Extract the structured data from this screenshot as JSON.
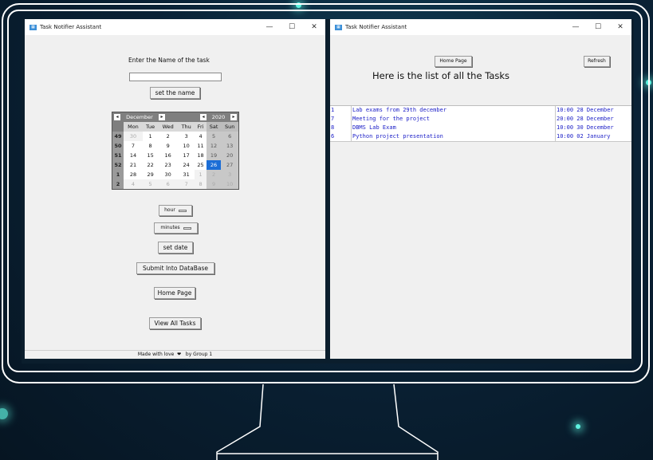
{
  "colors": {
    "background": "#0a2236",
    "accent_glow": "#5ef3e0",
    "list_text": "#1f22c8",
    "selected_day": "#1c6ed6"
  },
  "left_window": {
    "icon": "app-icon",
    "title": "Task Notifier Assistant",
    "controls": {
      "minimize": "—",
      "maximize": "☐",
      "close": "✕"
    },
    "task_label": "Enter the Name of the task",
    "task_input_value": "",
    "set_name_button": "set the name",
    "calendar": {
      "month": "December",
      "year": "2020",
      "prev_arrow": "◂",
      "next_arrow": "▸",
      "weekdays": [
        "Mon",
        "Tue",
        "Wed",
        "Thu",
        "Fri",
        "Sat",
        "Sun"
      ],
      "weeks": [
        {
          "num": "49",
          "days": [
            "30",
            "1",
            "2",
            "3",
            "4",
            "5",
            "6"
          ]
        },
        {
          "num": "50",
          "days": [
            "7",
            "8",
            "9",
            "10",
            "11",
            "12",
            "13"
          ]
        },
        {
          "num": "51",
          "days": [
            "14",
            "15",
            "16",
            "17",
            "18",
            "19",
            "20"
          ]
        },
        {
          "num": "52",
          "days": [
            "21",
            "22",
            "23",
            "24",
            "25",
            "26",
            "27"
          ]
        },
        {
          "num": "1",
          "days": [
            "28",
            "29",
            "30",
            "31",
            "1",
            "2",
            "3"
          ]
        },
        {
          "num": "2",
          "days": [
            "4",
            "5",
            "6",
            "7",
            "8",
            "9",
            "10"
          ]
        }
      ],
      "selected_day": "26"
    },
    "hour_menu": "hour",
    "minutes_menu": "minutes",
    "set_date_button": "set date",
    "submit_button": "Submit Into DataBase",
    "home_button": "Home Page",
    "view_all_button": "View All Tasks",
    "footer_text_1": "Made with love",
    "footer_heart": "❤",
    "footer_text_2": "by Group 1"
  },
  "right_window": {
    "icon": "app-icon",
    "title": "Task Notifier Assistant",
    "controls": {
      "minimize": "—",
      "maximize": "☐",
      "close": "✕"
    },
    "home_button": "Home Page",
    "refresh_button": "Refresh",
    "heading": "Here is the list of all the Tasks",
    "tasks": [
      {
        "id": "1",
        "name": "Lab exams from  29th december",
        "when": "10:00  28 December"
      },
      {
        "id": "7",
        "name": "Meeting for the project",
        "when": "20:00  28 December"
      },
      {
        "id": "8",
        "name": "DBMS Lab Exam",
        "when": "10:00  30 December"
      },
      {
        "id": "6",
        "name": "Python project presentation",
        "when": "10:00  02 January"
      }
    ]
  }
}
